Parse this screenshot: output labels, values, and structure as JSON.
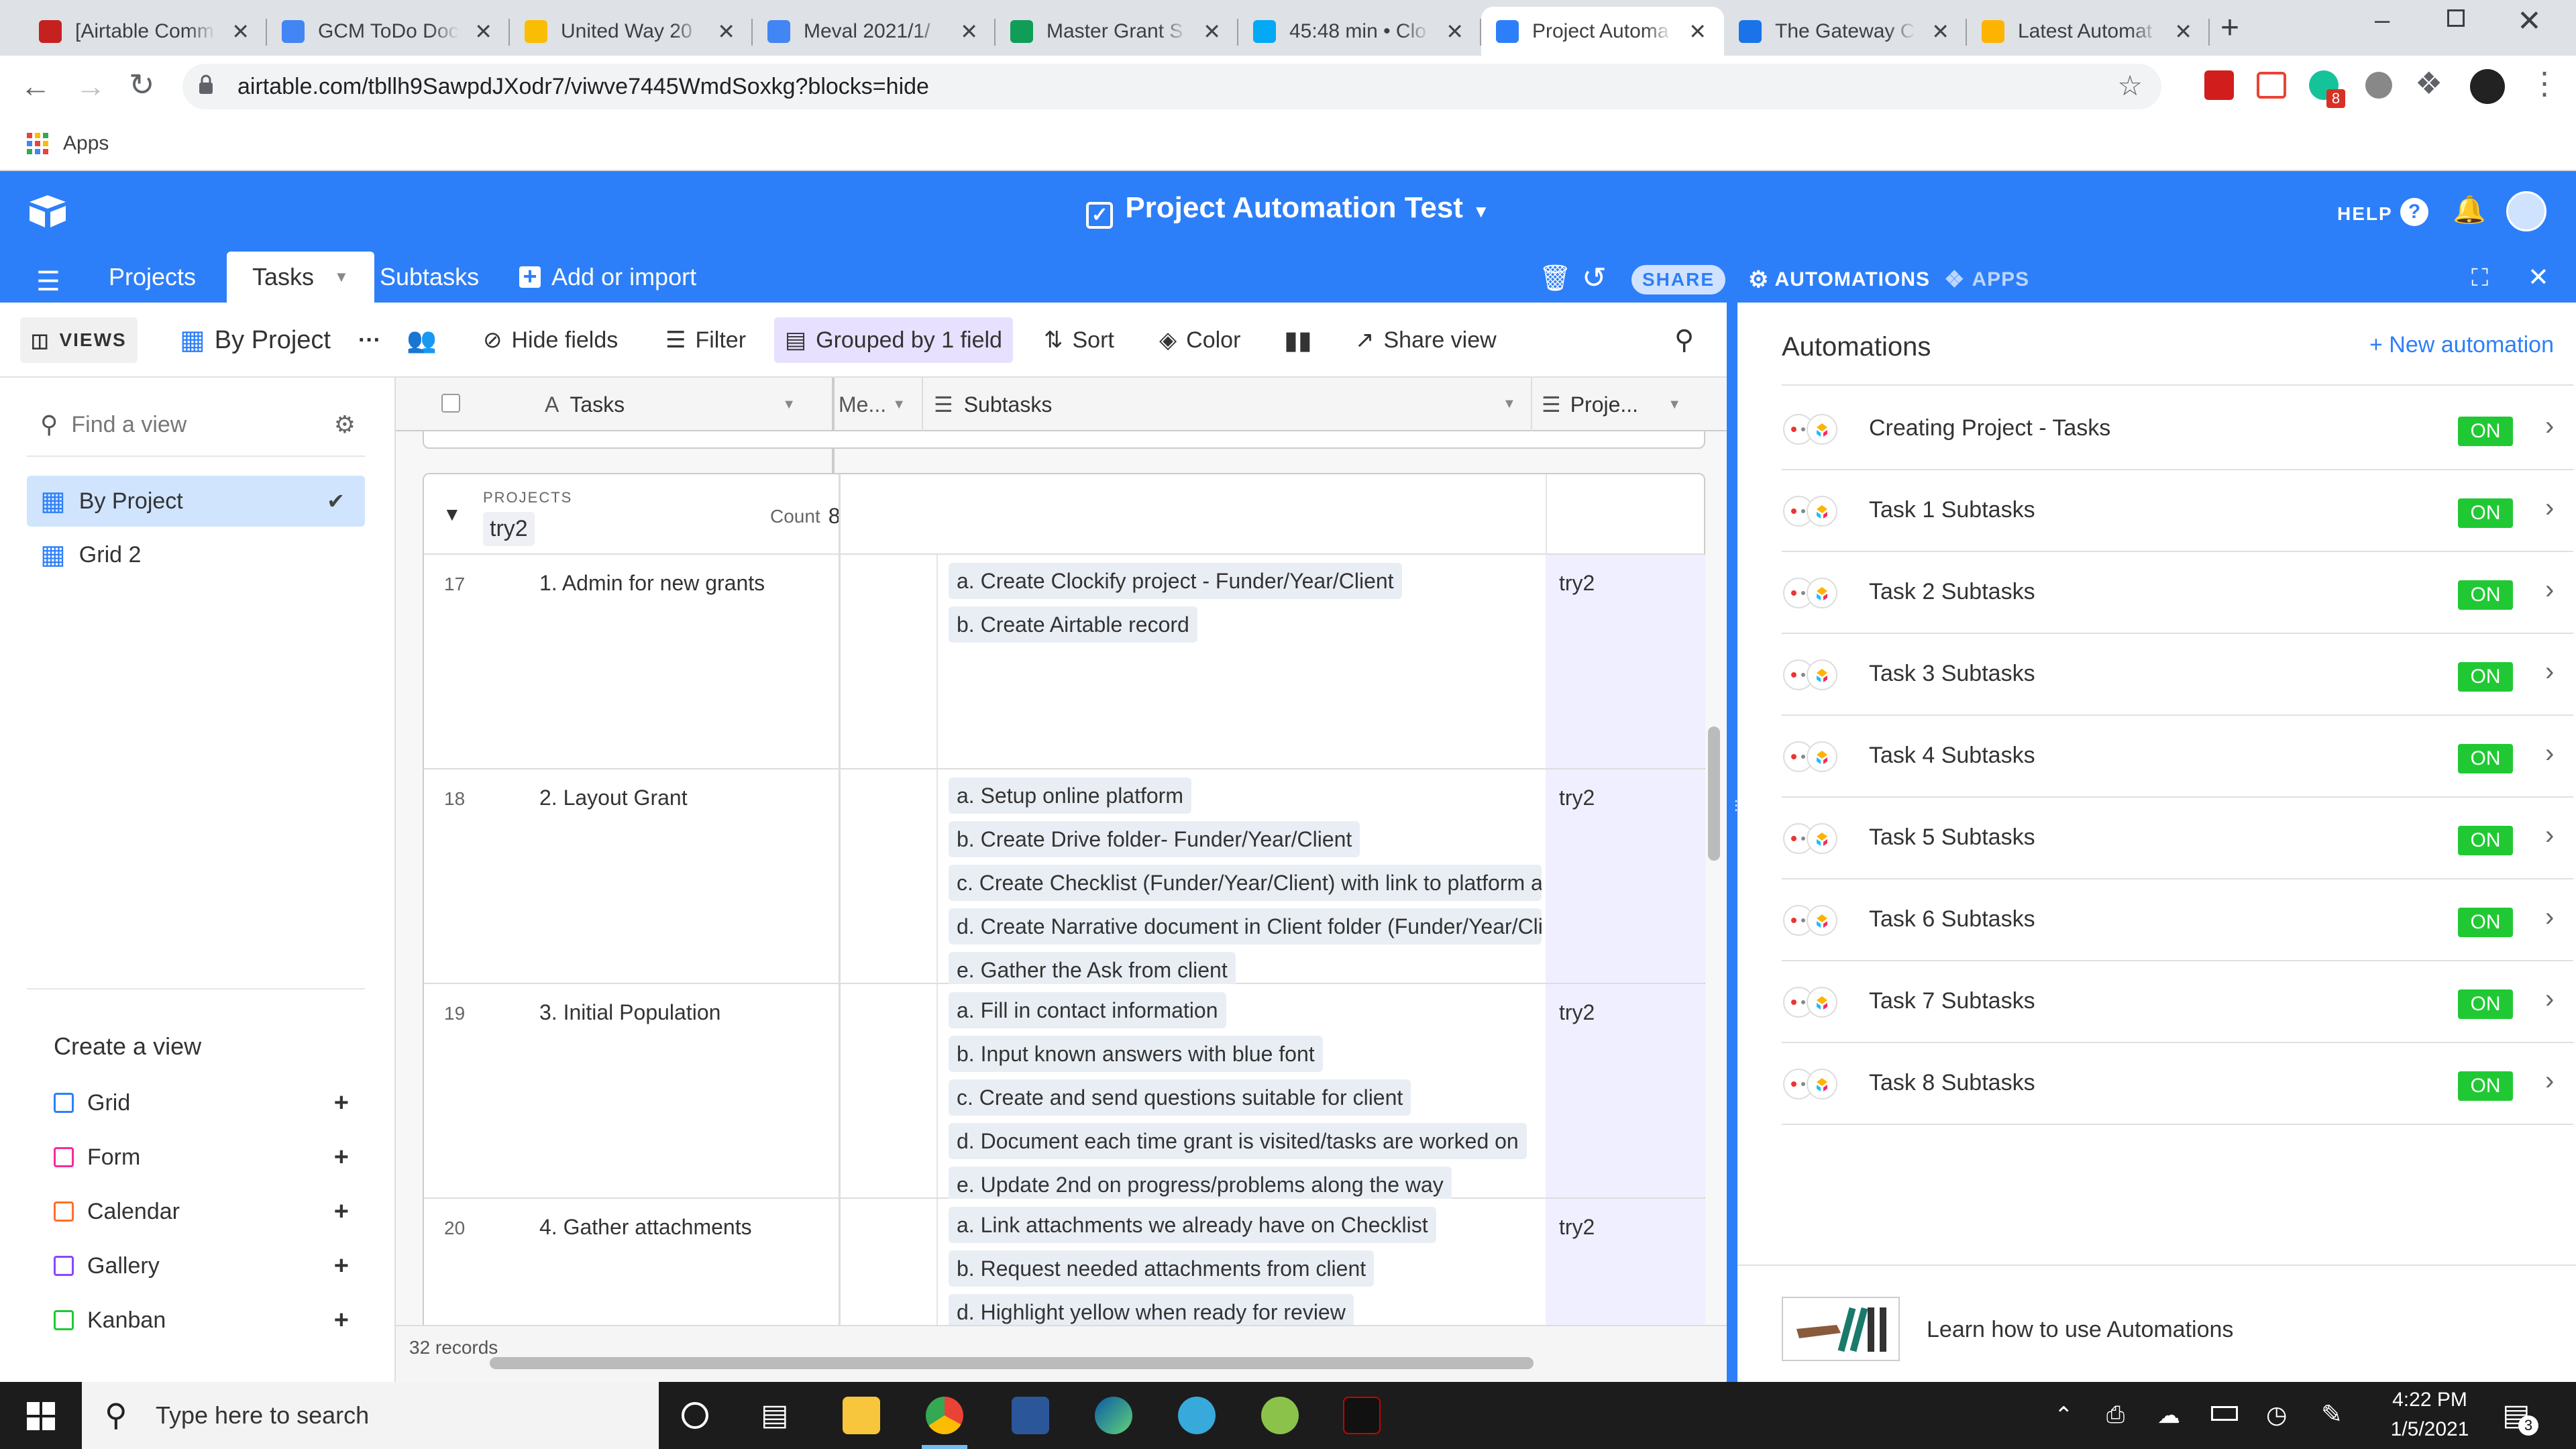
{
  "browser": {
    "tabs": [
      {
        "label": "[Airtable Comm",
        "color": "#c5221f"
      },
      {
        "label": "GCM ToDo Doc",
        "color": "#4285f4"
      },
      {
        "label": "United Way 20",
        "color": "#fbbc04"
      },
      {
        "label": "Meval 2021/1/",
        "color": "#4285f4"
      },
      {
        "label": "Master Grant S",
        "color": "#0f9d58"
      },
      {
        "label": "45:48 min • Clo",
        "color": "#03a9f4"
      },
      {
        "label": "Project Automa",
        "color": "#2d7ff9"
      },
      {
        "label": "The Gateway C",
        "color": "#1a73e8"
      },
      {
        "label": "Latest Automat",
        "color": "#fcb400"
      }
    ],
    "url": "airtable.com/tbllh9SawpdJXodr7/viwve7445WmdSoxkg?blocks=hide",
    "bookmarks_label": "Apps",
    "extension_badge": "8"
  },
  "airtable": {
    "base_title": "Project Automation Test",
    "help_label": "HELP",
    "tables": [
      "Projects",
      "Tasks",
      "Subtasks"
    ],
    "add_import_label": "Add or import",
    "share_label": "SHARE",
    "automations_label": "AUTOMATIONS",
    "apps_label": "APPS"
  },
  "viewbar": {
    "views_label": "VIEWS",
    "current_view": "By Project",
    "hide_fields": "Hide fields",
    "filter": "Filter",
    "grouped": "Grouped by 1 field",
    "sort": "Sort",
    "color": "Color",
    "share_view": "Share view"
  },
  "sidebar": {
    "find_placeholder": "Find a view",
    "views": [
      {
        "label": "By Project"
      },
      {
        "label": "Grid 2"
      }
    ],
    "create_title": "Create a view",
    "create_items": [
      {
        "label": "Grid",
        "color": "#2d7ff9"
      },
      {
        "label": "Form",
        "color": "#f82b98"
      },
      {
        "label": "Calendar",
        "color": "#ff6f2c"
      },
      {
        "label": "Gallery",
        "color": "#8b46ff"
      },
      {
        "label": "Kanban",
        "color": "#20c933"
      }
    ]
  },
  "grid": {
    "columns": {
      "tasks": "Tasks",
      "me": "Me...",
      "subtasks": "Subtasks",
      "proj": "Proje..."
    },
    "group_label": "PROJECTS",
    "group_value": "try2",
    "group_count_label": "Count",
    "group_count": "8",
    "records": [
      {
        "num": "17",
        "task": "1. Admin for new grants",
        "project": "try2",
        "subtasks": [
          "a. Create Clockify project - Funder/Year/Client",
          "b. Create Airtable record"
        ]
      },
      {
        "num": "18",
        "task": "2. Layout Grant",
        "project": "try2",
        "subtasks": [
          "a. Setup online platform",
          "b. Create Drive folder- Funder/Year/Client",
          "c. Create Checklist (Funder/Year/Client) with link to platform ar",
          "d. Create Narrative document in Client folder (Funder/Year/Clie",
          "e. Gather the Ask from client"
        ]
      },
      {
        "num": "19",
        "task": "3. Initial Population",
        "project": "try2",
        "subtasks": [
          "a. Fill in contact information",
          "b. Input known answers with blue font",
          "c. Create and send questions suitable for client",
          "d. Document each time grant is visited/tasks are worked on",
          "e. Update 2nd on progress/problems along the way"
        ]
      },
      {
        "num": "20",
        "task": "4. Gather attachments",
        "project": "try2",
        "subtasks": [
          "a. Link attachments we already have on Checklist",
          "b. Request needed attachments from client",
          "d. Highlight yellow when ready for review"
        ]
      }
    ],
    "records_count": "32 records"
  },
  "automations": {
    "title": "Automations",
    "new_label": "+ New automation",
    "on_label": "ON",
    "items": [
      {
        "name": "Creating Project - Tasks"
      },
      {
        "name": "Task 1 Subtasks"
      },
      {
        "name": "Task 2 Subtasks"
      },
      {
        "name": "Task 3 Subtasks"
      },
      {
        "name": "Task 4 Subtasks"
      },
      {
        "name": "Task 5 Subtasks"
      },
      {
        "name": "Task 6 Subtasks"
      },
      {
        "name": "Task 7 Subtasks"
      },
      {
        "name": "Task 8 Subtasks"
      }
    ],
    "learn_label": "Learn how to use Automations"
  },
  "taskbar": {
    "search_placeholder": "Type here to search",
    "time": "4:22 PM",
    "date": "1/5/2021",
    "notification_count": "3"
  }
}
